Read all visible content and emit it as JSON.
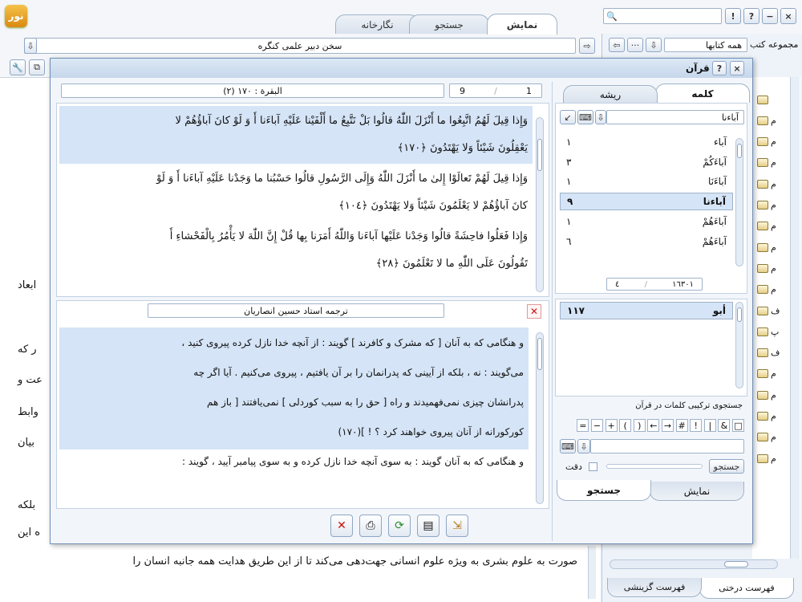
{
  "app_logo_text": "نور",
  "tabs": {
    "show": "نمایش",
    "search": "جستجو",
    "gallery": "نگارخانه"
  },
  "top_search": {
    "value": ""
  },
  "win_buttons": {
    "alert": "!",
    "help": "?",
    "min": "−",
    "close": "×"
  },
  "address": {
    "value": "سخن دبیر علمی کنگره"
  },
  "right_panel": {
    "title": "مجموعه کتب",
    "select_value": "همه کتابها",
    "bottom_tabs": [
      "فهرست درختی",
      "فهرست گزینشی"
    ]
  },
  "tree_items": [
    "",
    "م",
    "م",
    "م",
    "م",
    "م",
    "م",
    "م",
    "م",
    "م",
    "ف",
    "پ",
    "ف",
    "م",
    "م",
    "م",
    "م",
    "م"
  ],
  "bg_text": [
    "ابعاد",
    "ر که",
    "عت و",
    "وابط",
    "بیان",
    "بلکه",
    "ه این",
    "صورت به علوم بشری به ویژه علوم انسانی جهت‌دهی می‌کند تا از این طریق هدایت همه جانبه انسان را"
  ],
  "quran": {
    "title": "قرآن",
    "nav": {
      "verse_num": "9",
      "page_num": "1",
      "location": "(٢) البقرة : ١٧٠"
    },
    "verses": [
      {
        "l1": "وَإِذا قِیلَ لَهُمُ اتَّبِعُوا ما أَنْزَلَ اللّٰهُ قالُوا بَلْ نَتَّبِعُ ما أَلْفَیْنا عَلَیْهِ آباءَنا أَ وَ لَوْ کانَ آباؤُهُمْ لا",
        "l2": "یَعْقِلُونَ شَیْئاً وَلا یَهْتَدُونَ ﴿١٧٠﴾",
        "highlight": true
      },
      {
        "l1": "وَإِذا قِیلَ لَهُمْ تَعالَوْا إِلىٰ ما أَنْزَلَ اللّٰهُ وَإِلَى الرَّسُولِ قالُوا حَسْبُنا ما وَجَدْنا عَلَیْهِ آباءَنا أَ وَ لَوْ",
        "l2": "کانَ آباؤُهُمْ لا یَعْلَمُونَ شَیْئاً وَلا یَهْتَدُونَ ﴿١٠٤﴾",
        "highlight": false
      },
      {
        "l1": "وَإِذا فَعَلُوا فاحِشَةً قالُوا وَجَدْنا عَلَیْها آباءَنا وَاللّٰهُ أَمَرَنا بِها قُلْ إِنَّ اللّٰهَ لا یَأْمُرُ بِالْفَحْشاءِ أَ",
        "l2": "تَقُولُونَ عَلَى اللّٰهِ ما لا تَعْلَمُونَ ﴿٢٨﴾",
        "highlight": false
      }
    ],
    "translator": "ترجمه استاد حسین انصاریان",
    "translation": [
      "و هنگامی که به آنان [ که مشرک و کافرند ] گویند : از آنچه خدا نازل کرده پیروی کنید ،",
      "می‌گویند : نه ، بلکه از آیینی که پدرانمان را بر آن یافتیم ، پیروی می‌کنیم . آیا اگر چه",
      "پدرانشان چیزی نمی‌فهمیدند و راه [ حق را به سبب کوردلی ] نمی‌یافتند [ باز هم",
      "کورکورانه از آنان پیروی خواهند کرد ؟ ! ](١٧٠)",
      "و هنگامی که به آنان گویند : به سوی آنچه خدا نازل کرده و به سوی پیامبر آیید ، گویند :"
    ],
    "word_tabs": {
      "word": "کلمه",
      "root": "ریشه"
    },
    "word_search": {
      "value": "آباءنا"
    },
    "words": [
      {
        "w": "آباء",
        "n": "١"
      },
      {
        "w": "آباءَکُمْ",
        "n": "٣"
      },
      {
        "w": "آباءَنَا",
        "n": "١"
      },
      {
        "w": "آباءنا",
        "n": "٩"
      },
      {
        "w": "آباءَهُمْ",
        "n": "١"
      },
      {
        "w": "آباءَهُمْ",
        "n": "٦"
      }
    ],
    "word_count": {
      "left": "٤",
      "right": "١٦٣٠١"
    },
    "roots": [
      {
        "w": "أبو",
        "n": "١١٧"
      }
    ],
    "combo": {
      "title": "جستجوی ترکیبی کلمات در قرآن",
      "ops": [
        "□",
        "&",
        "|",
        "!",
        "#",
        "→",
        "←",
        ")",
        "(",
        "+",
        "−",
        "="
      ],
      "search_btn": "جستجو",
      "precision": "دقت"
    },
    "bottom_tabs": {
      "show": "نمایش",
      "search": "جستجو"
    },
    "toolbar_icons": [
      "close-icon",
      "print-icon",
      "refresh-icon",
      "page-icon",
      "export-icon"
    ]
  },
  "colors": {
    "accent": "#d5e4f6",
    "title_bar": "#c9d9ec",
    "close_red": "#cc1111",
    "green_word": "#2a8a2a"
  }
}
